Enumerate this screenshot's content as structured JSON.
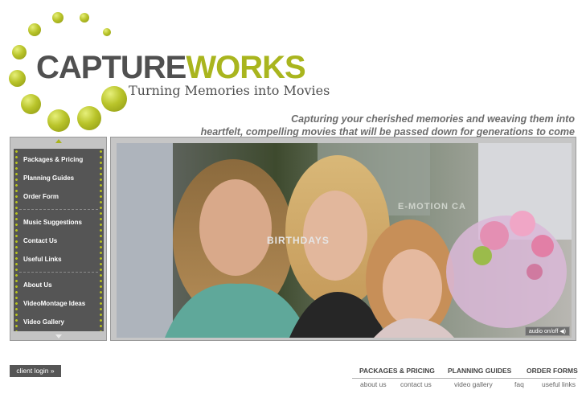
{
  "logo": {
    "capture": "CAPTURE",
    "works": "WORKS",
    "tagline": "Turning Memories into Movies"
  },
  "tagline": {
    "line1": "Capturing your cherished memories and weaving them into",
    "line2": "heartfelt, compelling movies that will be passed down for generations to come"
  },
  "sidebar": {
    "items": [
      {
        "label": "Packages & Pricing"
      },
      {
        "label": "Planning Guides"
      },
      {
        "label": "Order Form"
      },
      {
        "label": "Music Suggestions"
      },
      {
        "label": "Contact Us"
      },
      {
        "label": "Useful Links"
      },
      {
        "label": "About Us"
      },
      {
        "label": "VideoMontage Ideas"
      },
      {
        "label": "Video Gallery"
      }
    ]
  },
  "slideshow": {
    "caption_birthdays": "BIRTHDAYS",
    "caption_emotion": "E-MOTION CA",
    "audio_label": "audio on/off ◀)"
  },
  "client_login": "client login »",
  "bottom_nav": [
    "PACKAGES & PRICING",
    "PLANNING GUIDES",
    "ORDER FORMS"
  ],
  "footer_links": [
    "about us",
    "contact us",
    "video gallery",
    "faq",
    "useful links"
  ],
  "colors": {
    "accent": "#a9b51e",
    "logo_gray": "#505050",
    "nav_bg": "#555555"
  }
}
